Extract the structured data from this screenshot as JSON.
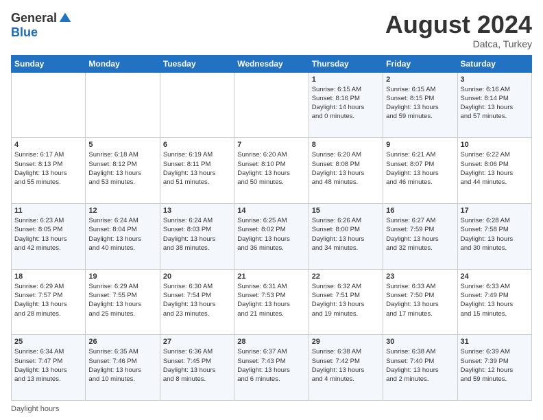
{
  "header": {
    "logo_general": "General",
    "logo_blue": "Blue",
    "month_title": "August 2024",
    "location": "Datca, Turkey"
  },
  "days_of_week": [
    "Sunday",
    "Monday",
    "Tuesday",
    "Wednesday",
    "Thursday",
    "Friday",
    "Saturday"
  ],
  "weeks": [
    [
      {
        "day": "",
        "info": ""
      },
      {
        "day": "",
        "info": ""
      },
      {
        "day": "",
        "info": ""
      },
      {
        "day": "",
        "info": ""
      },
      {
        "day": "1",
        "info": "Sunrise: 6:15 AM\nSunset: 8:16 PM\nDaylight: 14 hours\nand 0 minutes."
      },
      {
        "day": "2",
        "info": "Sunrise: 6:15 AM\nSunset: 8:15 PM\nDaylight: 13 hours\nand 59 minutes."
      },
      {
        "day": "3",
        "info": "Sunrise: 6:16 AM\nSunset: 8:14 PM\nDaylight: 13 hours\nand 57 minutes."
      }
    ],
    [
      {
        "day": "4",
        "info": "Sunrise: 6:17 AM\nSunset: 8:13 PM\nDaylight: 13 hours\nand 55 minutes."
      },
      {
        "day": "5",
        "info": "Sunrise: 6:18 AM\nSunset: 8:12 PM\nDaylight: 13 hours\nand 53 minutes."
      },
      {
        "day": "6",
        "info": "Sunrise: 6:19 AM\nSunset: 8:11 PM\nDaylight: 13 hours\nand 51 minutes."
      },
      {
        "day": "7",
        "info": "Sunrise: 6:20 AM\nSunset: 8:10 PM\nDaylight: 13 hours\nand 50 minutes."
      },
      {
        "day": "8",
        "info": "Sunrise: 6:20 AM\nSunset: 8:08 PM\nDaylight: 13 hours\nand 48 minutes."
      },
      {
        "day": "9",
        "info": "Sunrise: 6:21 AM\nSunset: 8:07 PM\nDaylight: 13 hours\nand 46 minutes."
      },
      {
        "day": "10",
        "info": "Sunrise: 6:22 AM\nSunset: 8:06 PM\nDaylight: 13 hours\nand 44 minutes."
      }
    ],
    [
      {
        "day": "11",
        "info": "Sunrise: 6:23 AM\nSunset: 8:05 PM\nDaylight: 13 hours\nand 42 minutes."
      },
      {
        "day": "12",
        "info": "Sunrise: 6:24 AM\nSunset: 8:04 PM\nDaylight: 13 hours\nand 40 minutes."
      },
      {
        "day": "13",
        "info": "Sunrise: 6:24 AM\nSunset: 8:03 PM\nDaylight: 13 hours\nand 38 minutes."
      },
      {
        "day": "14",
        "info": "Sunrise: 6:25 AM\nSunset: 8:02 PM\nDaylight: 13 hours\nand 36 minutes."
      },
      {
        "day": "15",
        "info": "Sunrise: 6:26 AM\nSunset: 8:00 PM\nDaylight: 13 hours\nand 34 minutes."
      },
      {
        "day": "16",
        "info": "Sunrise: 6:27 AM\nSunset: 7:59 PM\nDaylight: 13 hours\nand 32 minutes."
      },
      {
        "day": "17",
        "info": "Sunrise: 6:28 AM\nSunset: 7:58 PM\nDaylight: 13 hours\nand 30 minutes."
      }
    ],
    [
      {
        "day": "18",
        "info": "Sunrise: 6:29 AM\nSunset: 7:57 PM\nDaylight: 13 hours\nand 28 minutes."
      },
      {
        "day": "19",
        "info": "Sunrise: 6:29 AM\nSunset: 7:55 PM\nDaylight: 13 hours\nand 25 minutes."
      },
      {
        "day": "20",
        "info": "Sunrise: 6:30 AM\nSunset: 7:54 PM\nDaylight: 13 hours\nand 23 minutes."
      },
      {
        "day": "21",
        "info": "Sunrise: 6:31 AM\nSunset: 7:53 PM\nDaylight: 13 hours\nand 21 minutes."
      },
      {
        "day": "22",
        "info": "Sunrise: 6:32 AM\nSunset: 7:51 PM\nDaylight: 13 hours\nand 19 minutes."
      },
      {
        "day": "23",
        "info": "Sunrise: 6:33 AM\nSunset: 7:50 PM\nDaylight: 13 hours\nand 17 minutes."
      },
      {
        "day": "24",
        "info": "Sunrise: 6:33 AM\nSunset: 7:49 PM\nDaylight: 13 hours\nand 15 minutes."
      }
    ],
    [
      {
        "day": "25",
        "info": "Sunrise: 6:34 AM\nSunset: 7:47 PM\nDaylight: 13 hours\nand 13 minutes."
      },
      {
        "day": "26",
        "info": "Sunrise: 6:35 AM\nSunset: 7:46 PM\nDaylight: 13 hours\nand 10 minutes."
      },
      {
        "day": "27",
        "info": "Sunrise: 6:36 AM\nSunset: 7:45 PM\nDaylight: 13 hours\nand 8 minutes."
      },
      {
        "day": "28",
        "info": "Sunrise: 6:37 AM\nSunset: 7:43 PM\nDaylight: 13 hours\nand 6 minutes."
      },
      {
        "day": "29",
        "info": "Sunrise: 6:38 AM\nSunset: 7:42 PM\nDaylight: 13 hours\nand 4 minutes."
      },
      {
        "day": "30",
        "info": "Sunrise: 6:38 AM\nSunset: 7:40 PM\nDaylight: 13 hours\nand 2 minutes."
      },
      {
        "day": "31",
        "info": "Sunrise: 6:39 AM\nSunset: 7:39 PM\nDaylight: 12 hours\nand 59 minutes."
      }
    ]
  ],
  "footer": {
    "label": "Daylight hours"
  }
}
